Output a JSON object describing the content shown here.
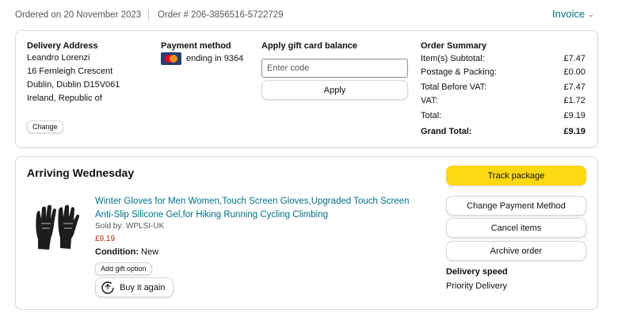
{
  "header": {
    "ordered_on": "Ordered on 20 November 2023",
    "order_number": "Order # 206-3856516-5722729",
    "invoice_label": "Invoice"
  },
  "delivery_address": {
    "heading": "Delivery Address",
    "lines": [
      "Leandro Lorenzi",
      "16 Fernleigh Crescent",
      "Dublin, Dublin D15V061",
      "Ireland, Republic of"
    ],
    "change_label": "Change"
  },
  "payment": {
    "heading": "Payment method",
    "card_text": "ending in 9364",
    "card_icon": "mastercard-icon"
  },
  "gift_card": {
    "heading": "Apply gift card balance",
    "placeholder": "Enter code",
    "value": "",
    "apply_label": "Apply"
  },
  "order_summary": {
    "heading": "Order Summary",
    "rows": [
      {
        "label": "Item(s) Subtotal:",
        "value": "£7.47"
      },
      {
        "label": "Postage & Packing:",
        "value": "£0.00"
      },
      {
        "label": "Total Before VAT:",
        "value": "£7.47"
      },
      {
        "label": "VAT:",
        "value": "£1.72"
      },
      {
        "label": "Total:",
        "value": "£9.19"
      }
    ],
    "grand_total_label": "Grand Total:",
    "grand_total_value": "£9.19"
  },
  "shipment": {
    "status": "Arriving Wednesday",
    "item": {
      "title": "Winter Gloves for Men Women,Touch Screen Gloves,Upgraded Touch Screen Anti-Slip Silicone Gel,for Hiking Running Cycling Climbing",
      "sold_by": "Sold by: WPLSI-UK",
      "price": "£9.19",
      "condition_label": "Condition:",
      "condition_value": "New",
      "add_gift_label": "Add gift option",
      "buy_again_label": "Buy it again",
      "image": "gloves-icon"
    },
    "actions": {
      "track": "Track package",
      "change_payment": "Change Payment Method",
      "cancel": "Cancel items",
      "archive": "Archive order"
    },
    "delivery_speed_heading": "Delivery speed",
    "delivery_speed_value": "Priority Delivery"
  },
  "colors": {
    "link": "#007185",
    "price": "#b12704",
    "track_button": "#ffd814",
    "border": "#d5d9d9"
  }
}
